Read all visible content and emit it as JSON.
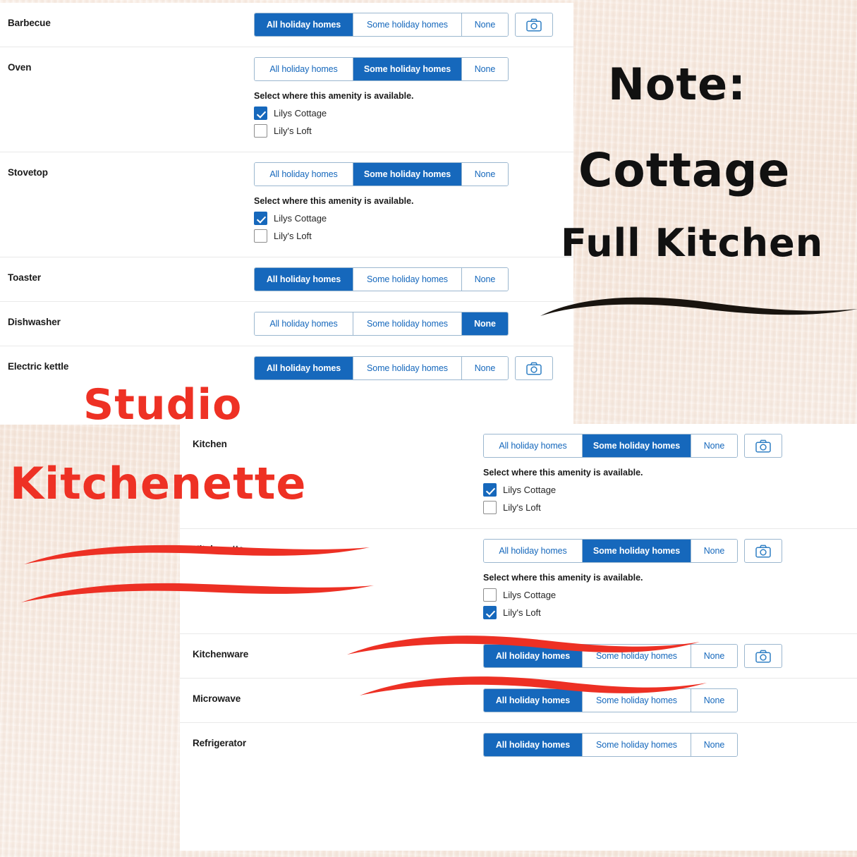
{
  "colors": {
    "accent_blue": "#1668bc",
    "annotation_red": "#ee3124",
    "annotation_black": "#111111",
    "paper_beige": "#f7ece4",
    "panel_white": "#ffffff",
    "border_blue": "#9bb7cf"
  },
  "segmented_options": {
    "all": "All holiday homes",
    "some": "Some holiday homes",
    "none": "None"
  },
  "subpanel": {
    "title": "Select where this amenity is available.",
    "property_one": "Lilys Cottage",
    "property_two": "Lily's Loft"
  },
  "icons": {
    "camera": "camera-icon"
  },
  "upper_screenshot": {
    "rows": [
      {
        "label": "Barbecue",
        "selected": "all",
        "has_camera": true,
        "has_subpanel": false,
        "checks": []
      },
      {
        "label": "Oven",
        "selected": "some",
        "has_camera": false,
        "has_subpanel": true,
        "checks": [
          true,
          false
        ]
      },
      {
        "label": "Stovetop",
        "selected": "some",
        "has_camera": false,
        "has_subpanel": true,
        "checks": [
          true,
          false
        ]
      },
      {
        "label": "Toaster",
        "selected": "all",
        "has_camera": false,
        "has_subpanel": false,
        "checks": []
      },
      {
        "label": "Dishwasher",
        "selected": "none",
        "has_camera": false,
        "has_subpanel": false,
        "checks": []
      },
      {
        "label": "Electric kettle",
        "selected": "all",
        "has_camera": true,
        "has_subpanel": false,
        "checks": []
      }
    ]
  },
  "lower_screenshot": {
    "rows": [
      {
        "label": "Kitchen",
        "selected": "some",
        "has_camera": true,
        "has_subpanel": true,
        "checks": [
          true,
          false
        ]
      },
      {
        "label": "Kitchenette",
        "selected": "some",
        "has_camera": true,
        "has_subpanel": true,
        "checks": [
          false,
          true
        ]
      },
      {
        "label": "Kitchenware",
        "selected": "all",
        "has_camera": true,
        "has_subpanel": false,
        "checks": []
      },
      {
        "label": "Microwave",
        "selected": "all",
        "has_camera": false,
        "has_subpanel": false,
        "checks": []
      },
      {
        "label": "Refrigerator",
        "selected": "all",
        "has_camera": false,
        "has_subpanel": false,
        "checks": []
      }
    ]
  },
  "annotations": {
    "note_line_1": "Note:",
    "note_line_2": "Cottage",
    "note_line_3": "Full Kitchen",
    "studio_word": "Studio",
    "kitchenette_word": "Kitchenette"
  }
}
